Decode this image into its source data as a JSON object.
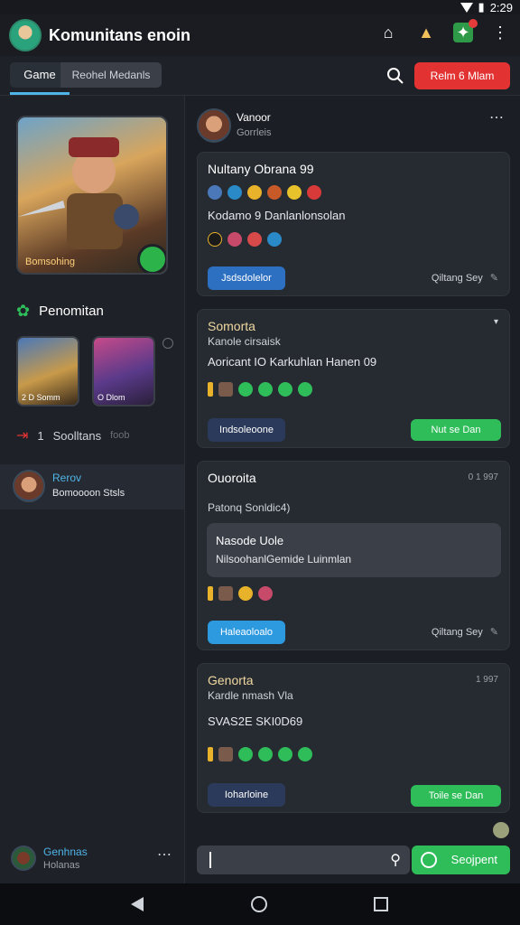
{
  "status_bar": {
    "time": "2:29"
  },
  "app": {
    "title": "Komunitans enoin"
  },
  "tabs": {
    "game": "Game",
    "other": "Reohel Medanls"
  },
  "top": {
    "red_button": "Relm 6 Mlam"
  },
  "sidebar": {
    "hero_label": "Bomsohing",
    "section_title": "Penomitan",
    "mini_cards": [
      "2 D Somm",
      "O Dlom"
    ],
    "line_item": {
      "count": "1",
      "label": "Soolltans",
      "sub": "foob"
    },
    "selected": {
      "name": "Rerov",
      "sub": "Bomoooon Stsls"
    },
    "bottom_user": {
      "name": "Genhnas",
      "sub": "Holanas"
    }
  },
  "main": {
    "header": {
      "name": "Vanoor",
      "sub": "Gorrleis"
    },
    "cards": [
      {
        "title": "Nultany Obrana 99",
        "line": "Kodamo 9 Danlanlonsolan",
        "button": "Jsdsdolelor",
        "meta": "Qiltang Sey"
      },
      {
        "title": "Somorta",
        "small": "Kanole cirsaisk",
        "line": "Aoricant IO Karkuhlan Hanen 09",
        "button": "Indsoleoone",
        "green_button": "Nut se Dan"
      },
      {
        "title": "Ouoroita",
        "time": "0 1 997",
        "small": "Patonq Sonldic4)",
        "quote_title": "Nasode Uole",
        "quote_line": "NilsoohanlGemide Luinmlan",
        "button": "Haleaoloalo",
        "meta": "Qiltang Sey"
      },
      {
        "title": "Genorta",
        "time": "1 997",
        "small": "Kardle nmash Vla",
        "line": "SVAS2E SKI0D69",
        "button": "Ioharloine",
        "green_button": "Toile se Dan"
      }
    ],
    "composer": {
      "send": "Seojpent"
    }
  },
  "colors": {
    "accent_blue": "#4fb4e8",
    "accent_green": "#2fbd5a",
    "accent_red": "#e23232"
  }
}
